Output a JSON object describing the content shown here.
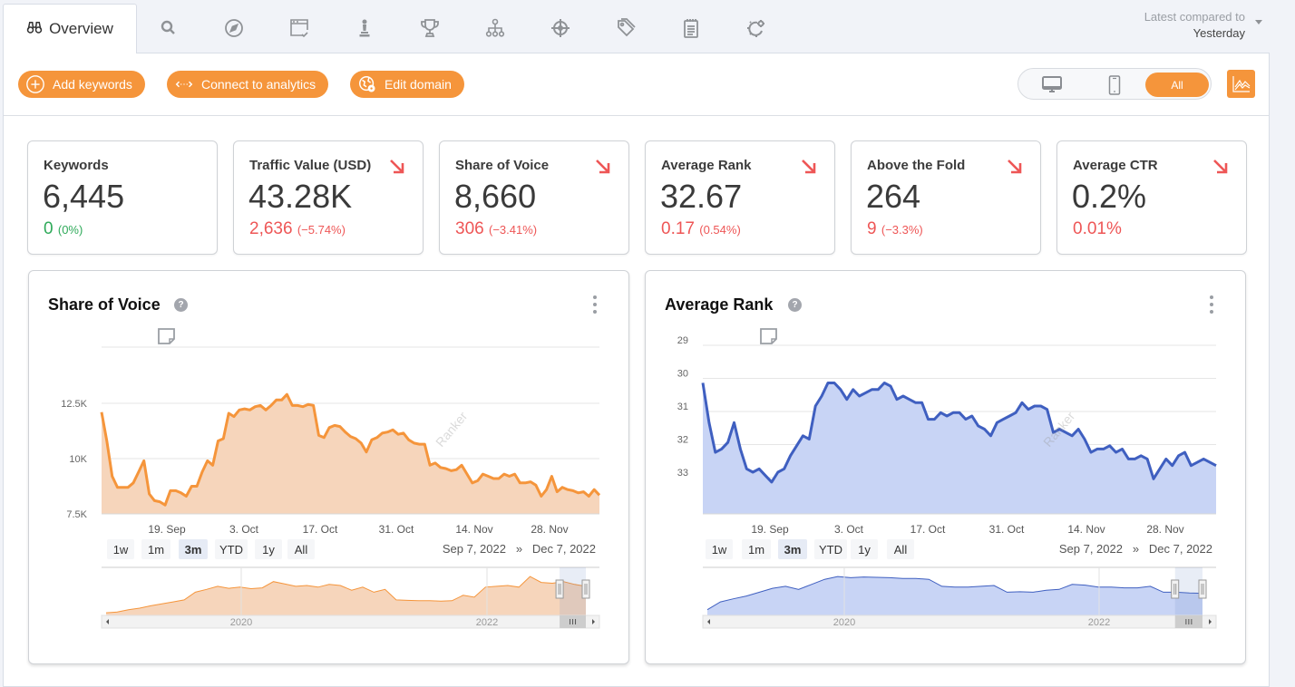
{
  "topbar": {
    "active_tab": {
      "label": "Overview",
      "icon": "binoculars-icon"
    },
    "tabs": [
      {
        "icon": "search-icon"
      },
      {
        "icon": "compass-icon"
      },
      {
        "icon": "browser-check-icon"
      },
      {
        "icon": "chess-pawn-icon"
      },
      {
        "icon": "trophy-icon"
      },
      {
        "icon": "sitemap-icon"
      },
      {
        "icon": "crosshair-icon"
      },
      {
        "icon": "tags-icon"
      },
      {
        "icon": "notepad-icon"
      },
      {
        "icon": "gears-icon"
      }
    ],
    "compare_label": "Latest compared to",
    "compare_value": "Yesterday"
  },
  "actions": {
    "add_keywords": "Add keywords",
    "connect_analytics": "Connect to analytics",
    "edit_domain": "Edit domain",
    "device_all": "All",
    "accent": "#f5953b"
  },
  "kpis": [
    {
      "title": "Keywords",
      "value": "6,445",
      "delta": "0",
      "delta_pct": "(0%)",
      "trend": "neutral"
    },
    {
      "title": "Traffic Value (USD)",
      "value": "43.28K",
      "delta": "2,636",
      "delta_pct": "(−5.74%)",
      "trend": "down"
    },
    {
      "title": "Share of Voice",
      "value": "8,660",
      "delta": "306",
      "delta_pct": "(−3.41%)",
      "trend": "down"
    },
    {
      "title": "Average Rank",
      "value": "32.67",
      "delta": "0.17",
      "delta_pct": "(0.54%)",
      "trend": "down"
    },
    {
      "title": "Above the Fold",
      "value": "264",
      "delta": "9",
      "delta_pct": "(−3.3%)",
      "trend": "down"
    },
    {
      "title": "Average CTR",
      "value": "0.2%",
      "delta": "0.01%",
      "delta_pct": "",
      "trend": "down"
    }
  ],
  "range_buttons": [
    "1w",
    "1m",
    "3m",
    "YTD",
    "1y",
    "All"
  ],
  "range_selected": "3m",
  "range_from": "Sep 7, 2022",
  "range_sep": "»",
  "range_to": "Dec 7, 2022",
  "chart_data": [
    {
      "type": "area",
      "title": "Share of Voice",
      "watermark": "Ranker",
      "color": "#f5953b",
      "fill": "#f6d5bb",
      "xlabel": "",
      "ylabel": "",
      "x_ticks": [
        "19. Sep",
        "3. Oct",
        "17. Oct",
        "31. Oct",
        "14. Nov",
        "28. Nov"
      ],
      "y_ticks": [
        "7.5K",
        "10K",
        "12.5K"
      ],
      "ylim": [
        7500,
        15000
      ],
      "grid": true,
      "values": [
        12100,
        10800,
        9200,
        8700,
        8700,
        8700,
        8900,
        9400,
        9900,
        8400,
        8100,
        8050,
        7900,
        8550,
        8550,
        8450,
        8300,
        8750,
        8750,
        9400,
        9900,
        9700,
        10800,
        10900,
        12050,
        11900,
        12200,
        12250,
        12200,
        12350,
        12400,
        12200,
        12400,
        12650,
        12650,
        12900,
        12400,
        12400,
        12350,
        12450,
        12400,
        11050,
        10950,
        11400,
        11500,
        11450,
        11200,
        11000,
        10900,
        10700,
        10300,
        10850,
        10950,
        11150,
        11200,
        11300,
        11100,
        11150,
        10850,
        10700,
        10650,
        10650,
        9700,
        9800,
        9600,
        9550,
        9450,
        9500,
        9700,
        9300,
        8900,
        9000,
        9300,
        9200,
        9100,
        9100,
        9300,
        9200,
        9300,
        8900,
        8900,
        8950,
        8800,
        8300,
        8600,
        9200,
        8500,
        8700,
        8600,
        8550,
        8450,
        8500,
        8300,
        8600,
        8350
      ],
      "navigator": {
        "labels": [
          "2020",
          "2022"
        ],
        "values": [
          0.02,
          0.04,
          0.1,
          0.14,
          0.2,
          0.25,
          0.3,
          0.35,
          0.55,
          0.62,
          0.7,
          0.65,
          0.68,
          0.64,
          0.66,
          0.82,
          0.76,
          0.7,
          0.72,
          0.68,
          0.75,
          0.72,
          0.6,
          0.68,
          0.55,
          0.62,
          0.35,
          0.34,
          0.33,
          0.33,
          0.32,
          0.33,
          0.47,
          0.42,
          0.68,
          0.7,
          0.72,
          0.68,
          0.95,
          0.8,
          0.78,
          0.82,
          0.75,
          0.7
        ],
        "window": [
          0.92,
          1.0
        ]
      }
    },
    {
      "type": "area",
      "title": "Average Rank",
      "watermark": "Ranker",
      "color": "#3f5fc0",
      "fill": "#c8d4f5",
      "xlabel": "",
      "ylabel": "",
      "inverted_y": true,
      "x_ticks": [
        "19. Sep",
        "3. Oct",
        "17. Oct",
        "31. Oct",
        "14. Nov",
        "28. Nov"
      ],
      "y_ticks": [
        "29",
        "30",
        "31",
        "32",
        "33"
      ],
      "ylim": [
        29,
        34.2
      ],
      "grid": true,
      "values": [
        30.3,
        31.5,
        32.4,
        32.3,
        32.1,
        31.5,
        32.3,
        32.9,
        33.0,
        32.9,
        33.1,
        33.3,
        33.0,
        32.9,
        32.5,
        32.2,
        31.9,
        32.0,
        31.0,
        30.7,
        30.3,
        30.3,
        30.5,
        30.8,
        30.5,
        30.7,
        30.6,
        30.5,
        30.5,
        30.3,
        30.4,
        30.8,
        30.7,
        30.8,
        30.9,
        30.9,
        31.4,
        31.4,
        31.2,
        31.3,
        31.2,
        31.2,
        31.4,
        31.3,
        31.6,
        31.7,
        31.9,
        31.5,
        31.4,
        31.3,
        31.2,
        30.9,
        31.1,
        31.0,
        31.0,
        31.1,
        31.8,
        31.7,
        31.8,
        31.9,
        31.7,
        32.0,
        32.4,
        32.3,
        32.3,
        32.2,
        32.4,
        32.3,
        32.6,
        32.6,
        32.5,
        32.6,
        33.2,
        32.9,
        32.6,
        32.8,
        32.5,
        32.4,
        32.8,
        32.7,
        32.6,
        32.7,
        32.8
      ],
      "navigator": {
        "labels": [
          "2020",
          "2022"
        ],
        "values": [
          0.1,
          0.3,
          0.38,
          0.45,
          0.55,
          0.65,
          0.7,
          0.62,
          0.75,
          0.88,
          0.95,
          0.92,
          0.94,
          0.93,
          0.92,
          0.9,
          0.9,
          0.88,
          0.7,
          0.68,
          0.68,
          0.7,
          0.72,
          0.55,
          0.56,
          0.55,
          0.6,
          0.62,
          0.75,
          0.73,
          0.68,
          0.68,
          0.66,
          0.66,
          0.7,
          0.55,
          0.55,
          0.53,
          0.52
        ],
        "window": [
          0.92,
          1.0
        ]
      }
    }
  ]
}
